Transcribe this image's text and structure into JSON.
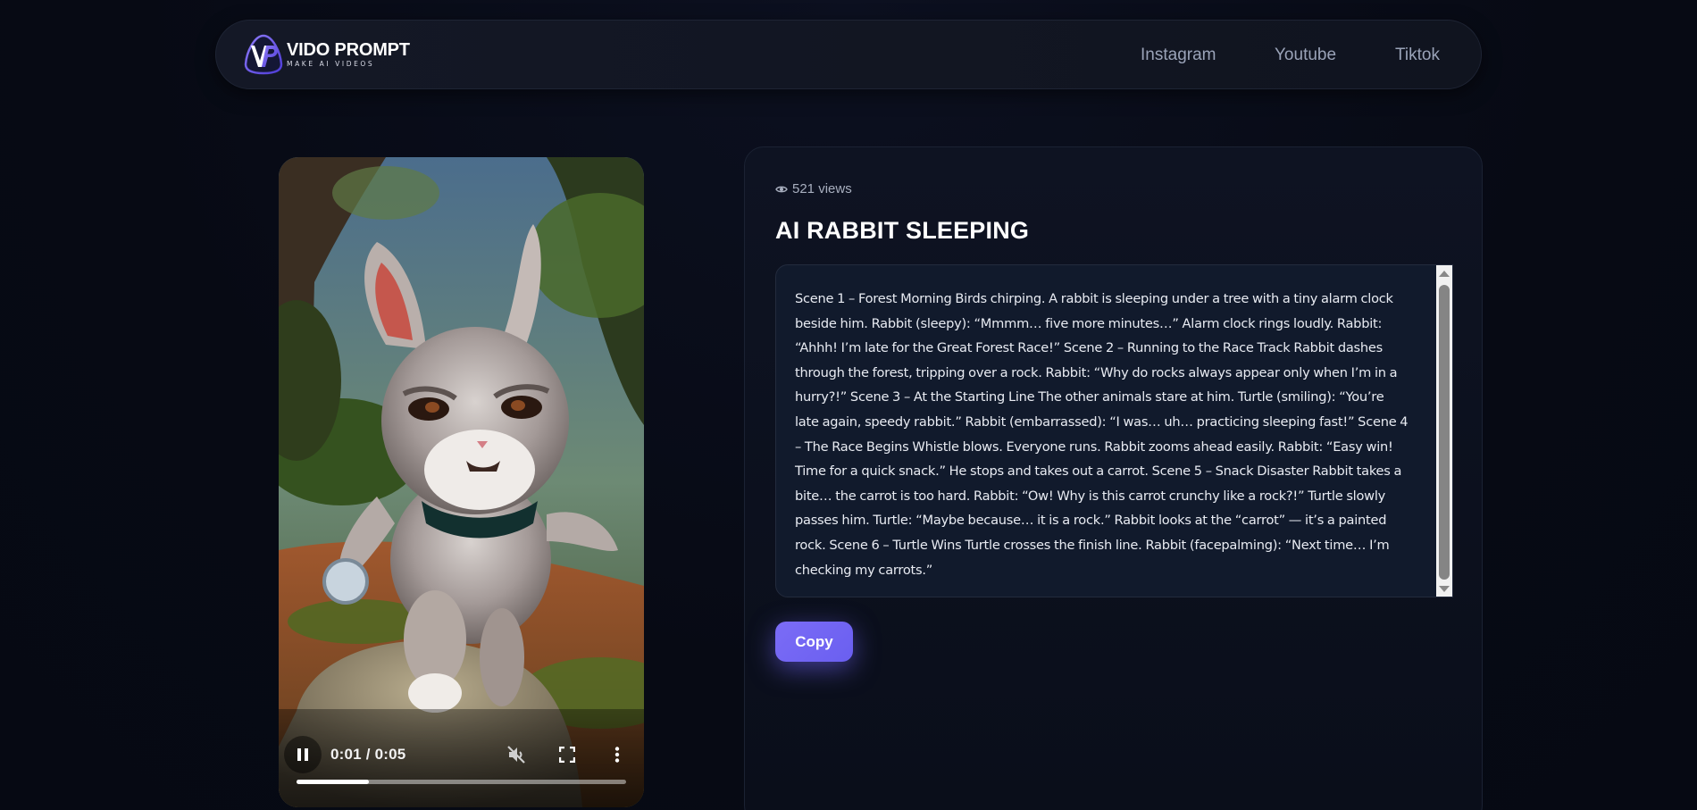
{
  "header": {
    "logo": {
      "title": "VIDO PROMPT",
      "subtitle": "MAKE AI VIDEOS",
      "accent": "#6c5ce7"
    },
    "nav": [
      {
        "label": "Instagram"
      },
      {
        "label": "Youtube"
      },
      {
        "label": "Tiktok"
      }
    ]
  },
  "video": {
    "state": "playing",
    "time_display": "0:01 / 0:05",
    "progress": 0.22,
    "muted": true,
    "controls": [
      "pause-icon",
      "mute-icon",
      "fullscreen-icon",
      "more-options-icon"
    ]
  },
  "detail": {
    "views": "521 views",
    "title": "AI RABBIT SLEEPING",
    "prompt": "Scene 1 – Forest Morning Birds chirping. A rabbit is sleeping under a tree with a tiny alarm clock beside him. Rabbit (sleepy): “Mmmm… five more minutes…” Alarm clock rings loudly. Rabbit: “Ahhh! I’m late for the Great Forest Race!” Scene 2 – Running to the Race Track Rabbit dashes through the forest, tripping over a rock. Rabbit: “Why do rocks always appear only when I’m in a hurry?!” Scene 3 – At the Starting Line The other animals stare at him. Turtle (smiling): “You’re late again, speedy rabbit.” Rabbit (embarrassed): “I was… uh… practicing sleeping fast!” Scene 4 – The Race Begins Whistle blows. Everyone runs. Rabbit zooms ahead easily. Rabbit: “Easy win! Time for a quick snack.” He stops and takes out a carrot. Scene 5 – Snack Disaster Rabbit takes a bite… the carrot is too hard. Rabbit: “Ow! Why is this carrot crunchy like a rock?!” Turtle slowly passes him. Turtle: “Maybe because… it is a rock.” Rabbit looks at the “carrot” — it’s a painted rock. Scene 6 – Turtle Wins Turtle crosses the finish line. Rabbit (facepalming): “Next time… I’m checking my carrots.”",
    "copy_label": "Copy"
  },
  "colors": {
    "background": "#080b16",
    "card": "#0e1322",
    "button": "#7064f2"
  }
}
